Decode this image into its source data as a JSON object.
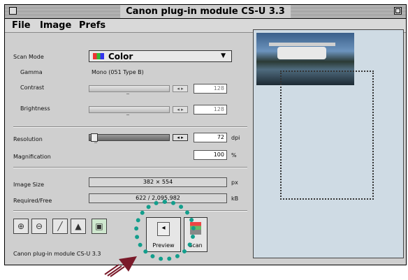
{
  "window": {
    "title": "Canon plug-in module CS-U 3.3"
  },
  "menu": {
    "file": "File",
    "image": "Image",
    "prefs": "Prefs"
  },
  "scan_mode": {
    "label": "Scan Mode",
    "value": "Color"
  },
  "gamma": {
    "label": "Gamma",
    "value": "Mono (051 Type B)"
  },
  "contrast": {
    "label": "Contrast",
    "value": "128"
  },
  "brightness": {
    "label": "Brightness",
    "value": "128"
  },
  "resolution": {
    "label": "Resolution",
    "value": "72",
    "unit": "dpi"
  },
  "magnification": {
    "label": "Magnification",
    "value": "100",
    "unit": "%"
  },
  "image_size": {
    "label": "Image Size",
    "value": "382 × 554",
    "unit": "px"
  },
  "required_free": {
    "label": "Required/Free",
    "value": "622 / 2,095,982",
    "unit": "kB"
  },
  "buttons": {
    "preview": "Preview",
    "scan": "Scan"
  },
  "status": "Canon plug-in module CS-U 3.3",
  "colors": {
    "annotation_circle": "#139e8c",
    "annotation_arrow": "#7a1a2a"
  }
}
